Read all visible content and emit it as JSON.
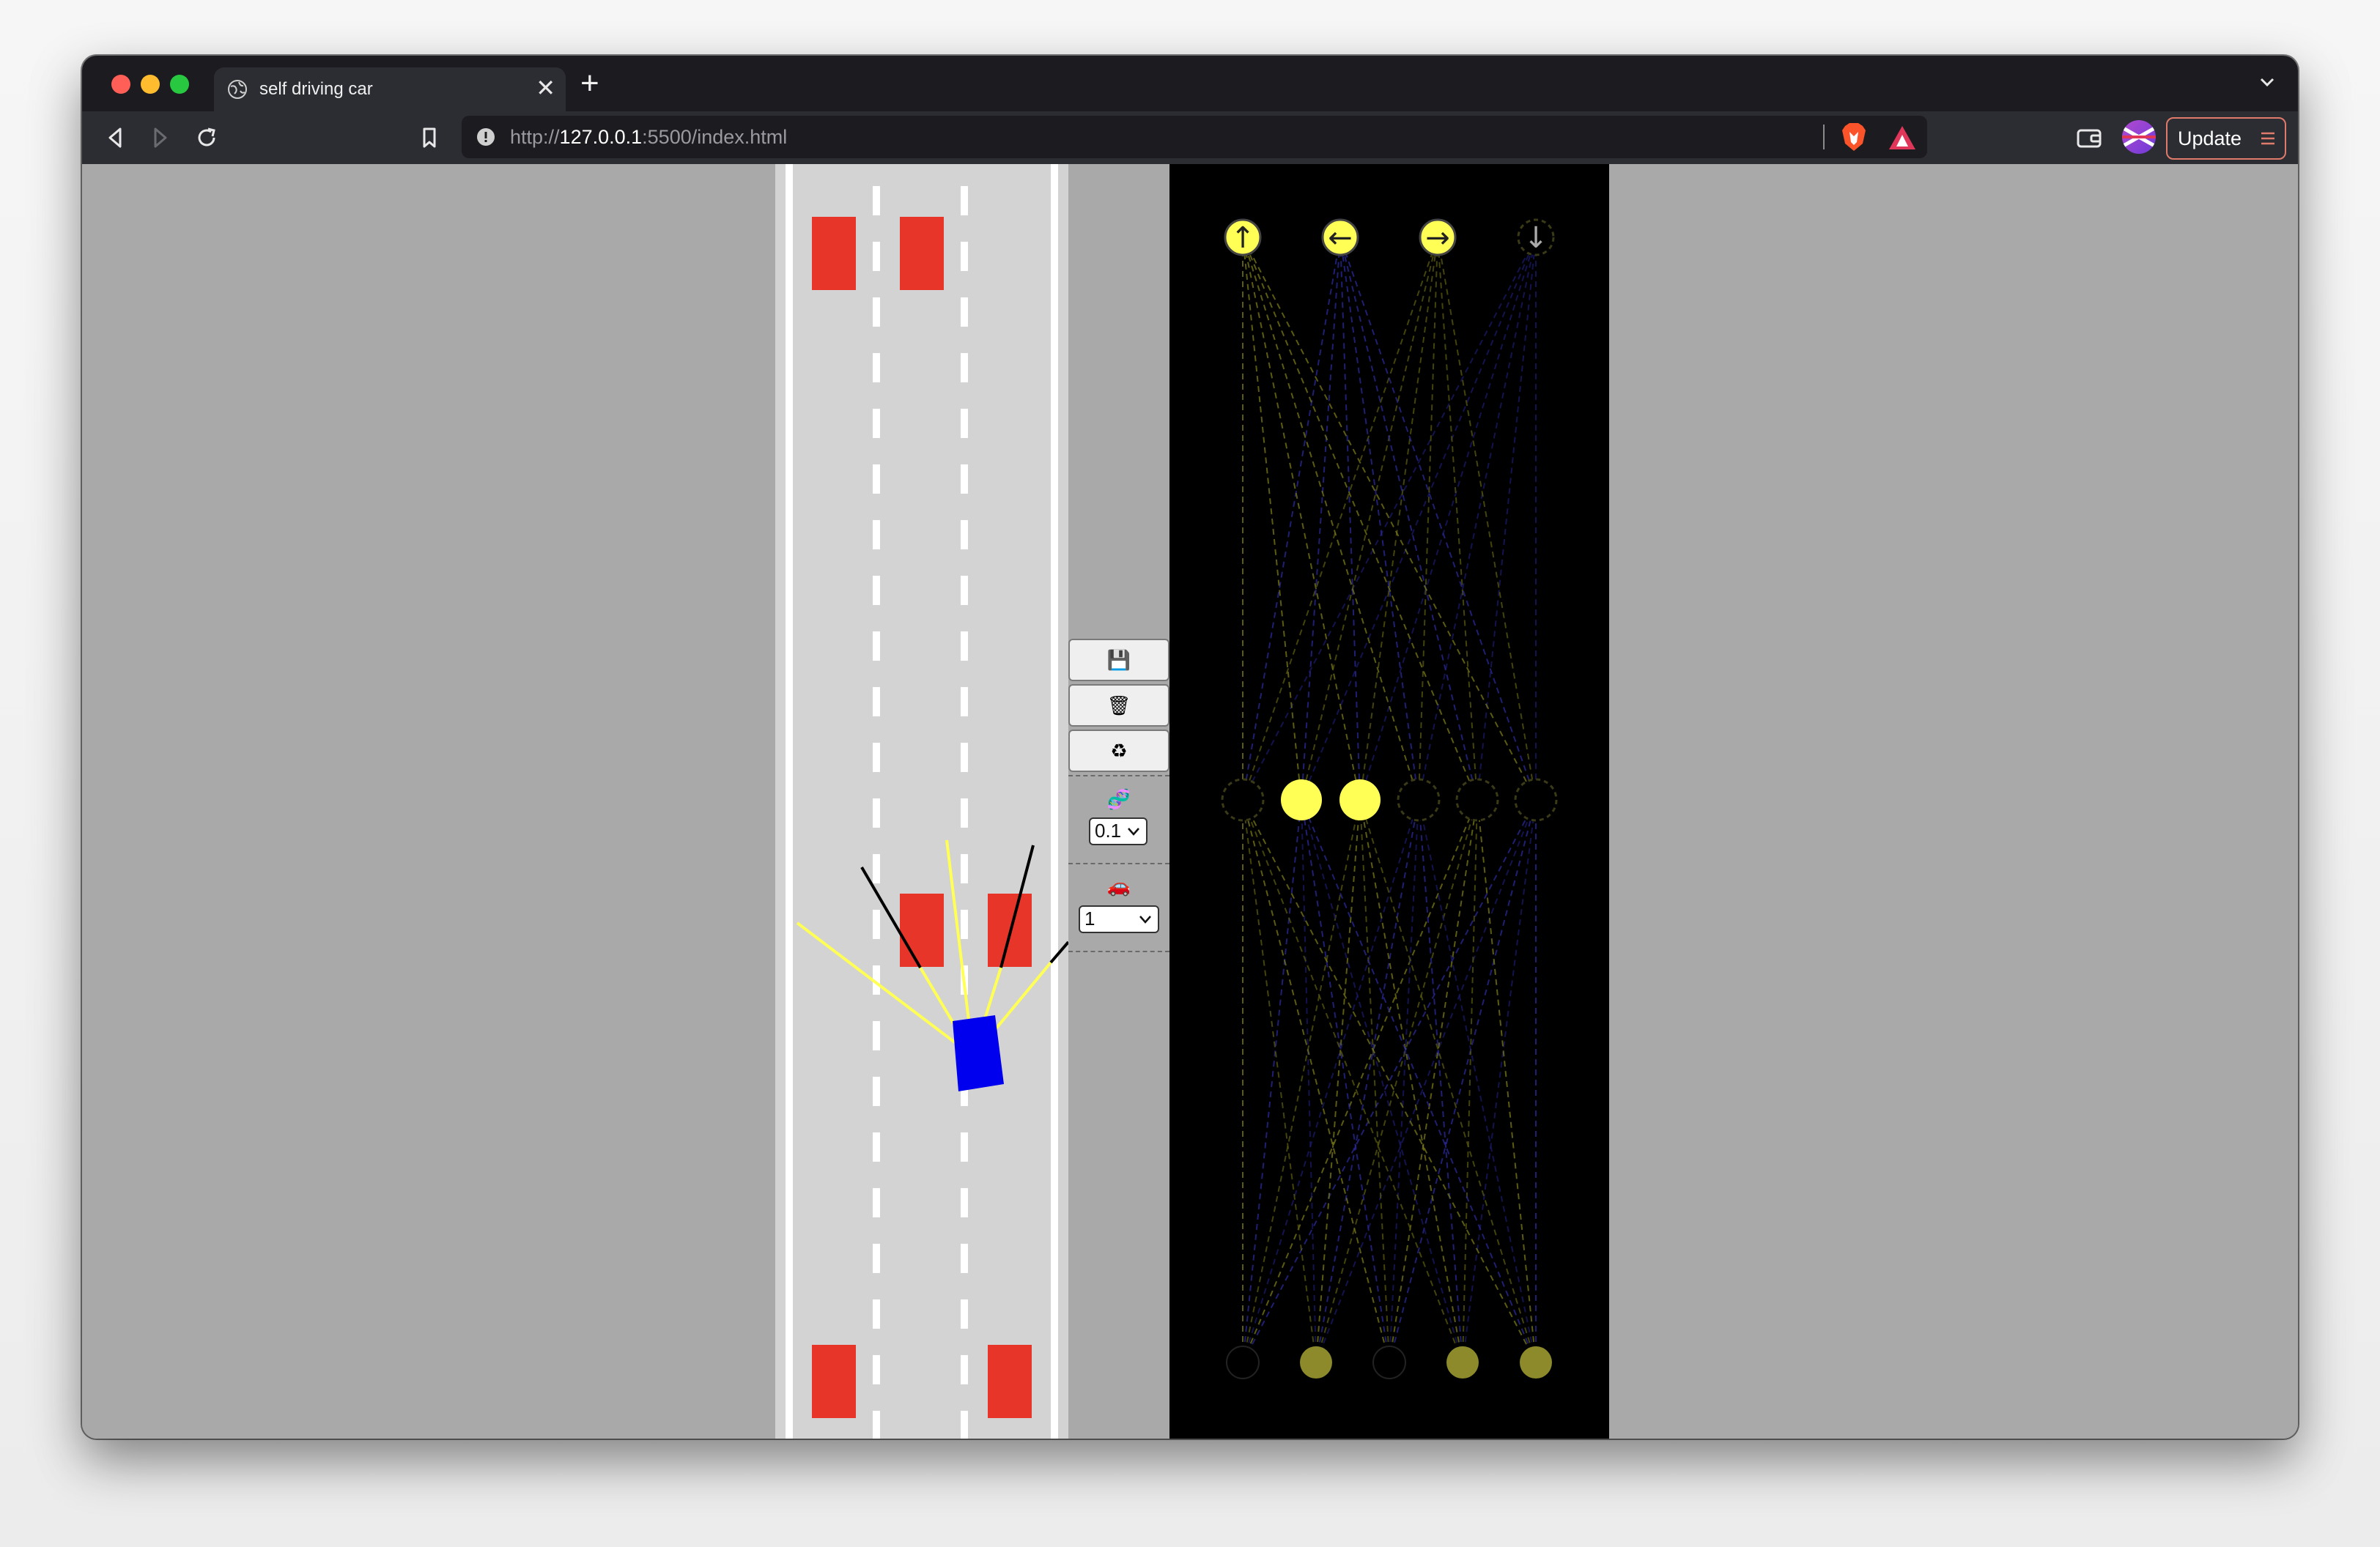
{
  "tab": {
    "title": "self driving car",
    "close_glyph": "✕",
    "new_tab_glyph": "+"
  },
  "address_bar": {
    "scheme": "http://",
    "host": "127.0.0.1",
    "rest": ":5500/index.html"
  },
  "toolbar": {
    "update_label": "Update"
  },
  "controls": {
    "save_icon": "💾",
    "discard_icon": "🗑",
    "reset_icon": "♻",
    "mutation_icon": "🧬",
    "mutation_value": "0.1",
    "cars_icon": "🚗",
    "cars_value": "1"
  },
  "colors": {
    "road": "#d3d3d3",
    "traffic_car": "#e8352a",
    "player_car": "#0000ee",
    "sensor_ray": "#ffff55",
    "network_bg": "#000000",
    "active_node": "#ffff55",
    "dim_node": "#8c8a2a",
    "update_border": "#e07a6a"
  },
  "icons": {
    "globe": "globe-icon",
    "back": "back-arrow-icon",
    "forward": "forward-arrow-icon",
    "reload": "reload-icon",
    "bookmark": "bookmark-icon",
    "info": "info-icon",
    "brave": "brave-shield-icon",
    "rewards": "brave-rewards-icon",
    "wallet": "wallet-icon",
    "profile": "profile-avatar",
    "menu": "hamburger-menu-icon"
  },
  "network": {
    "output_labels": [
      "↑",
      "←",
      "→",
      "↓"
    ],
    "output_active": [
      true,
      true,
      true,
      false
    ],
    "hidden_active": [
      false,
      true,
      true,
      false,
      false,
      false
    ],
    "input_levels": [
      0,
      0.55,
      0,
      0.55,
      0.55
    ]
  }
}
